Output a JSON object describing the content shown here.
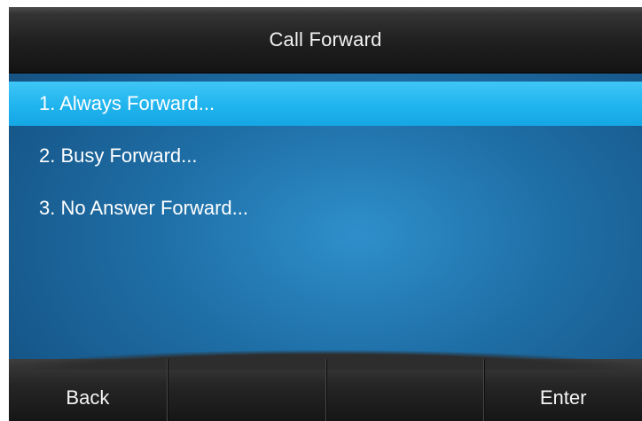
{
  "header": {
    "title": "Call Forward"
  },
  "menu": {
    "items": [
      {
        "label": "1. Always Forward...",
        "selected": true
      },
      {
        "label": "2. Busy Forward...",
        "selected": false
      },
      {
        "label": "3. No Answer Forward...",
        "selected": false
      }
    ]
  },
  "softkeys": [
    {
      "label": "Back"
    },
    {
      "label": ""
    },
    {
      "label": ""
    },
    {
      "label": "Enter"
    }
  ],
  "colors": {
    "selection": "#20b4ee",
    "background": "#1f6fa7",
    "bar": "#1f1f1f"
  }
}
